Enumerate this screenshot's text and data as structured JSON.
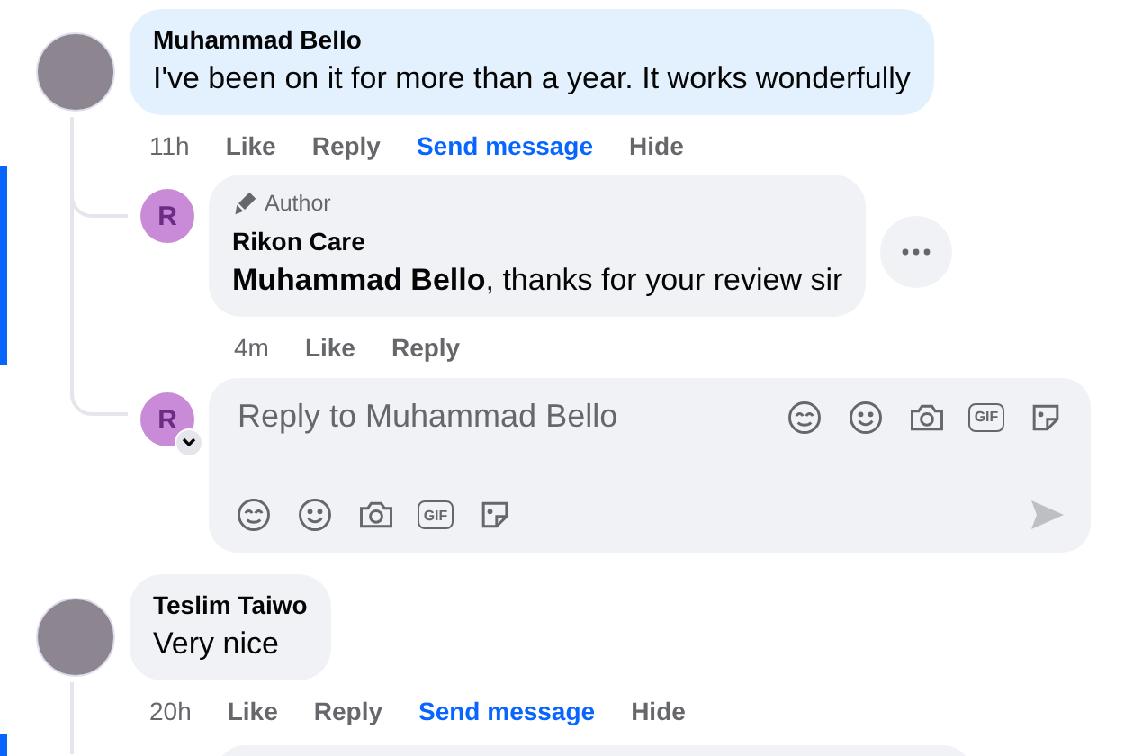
{
  "comments": [
    {
      "kind": "comment",
      "author": "Muhammad Bello",
      "text": "I've been on it for more than a year. It works wonderfully",
      "highlighted": true,
      "time": "11h",
      "actions": [
        {
          "label": "Like",
          "color": "#65676b"
        },
        {
          "label": "Reply",
          "color": "#65676b"
        },
        {
          "label": "Send message",
          "color": "#0866ff"
        },
        {
          "label": "Hide",
          "color": "#65676b"
        }
      ],
      "replies": [
        {
          "badge": "Author",
          "initial": "R",
          "author": "Rikon Care",
          "text": "**Muhammad Bello**, thanks for your review sir",
          "time": "4m",
          "actions": [
            {
              "label": "Like",
              "color": "#65676b"
            },
            {
              "label": "Reply",
              "color": "#65676b"
            }
          ]
        }
      ],
      "composer": {
        "initial": "R",
        "placeholder": "Reply to Muhammad Bello",
        "top_icons": [
          {
            "kind": "avatar"
          },
          {
            "kind": "emoji"
          },
          {
            "kind": "camera"
          },
          {
            "kind": "gif",
            "label": "GIF"
          },
          {
            "kind": "sticker"
          }
        ],
        "bottom_icons": [
          {
            "kind": "avatar"
          },
          {
            "kind": "emoji"
          },
          {
            "kind": "camera"
          },
          {
            "kind": "gif",
            "label": "GIF"
          },
          {
            "kind": "sticker"
          }
        ]
      }
    },
    {
      "kind": "comment",
      "author": "Teslim Taiwo",
      "text": "Very nice",
      "highlighted": false,
      "time": "20h",
      "actions": [
        {
          "label": "Like",
          "color": "#65676b"
        },
        {
          "label": "Reply",
          "color": "#65676b"
        },
        {
          "label": "Send message",
          "color": "#0866ff"
        },
        {
          "label": "Hide",
          "color": "#65676b"
        }
      ]
    }
  ]
}
